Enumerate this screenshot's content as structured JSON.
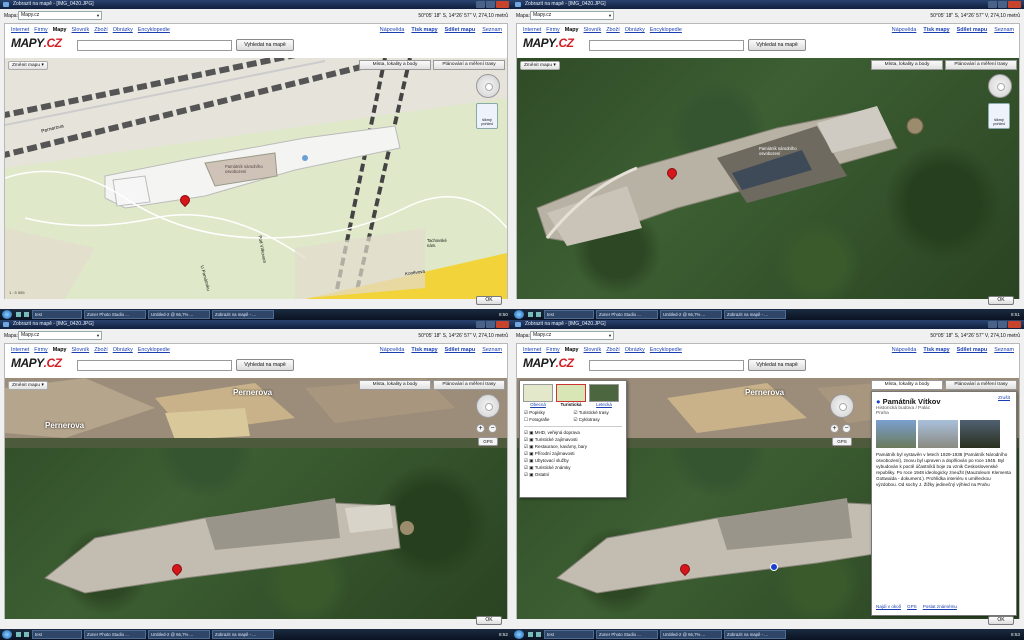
{
  "window": {
    "title": "Zobrazit na mapě - [IMG_0420.JPG]",
    "map_label": "Mapa:",
    "map_select": "Mapy.cz",
    "coords": "50°05' 18\" S, 14°26' 57\" V, 274,10 metrů",
    "ok": "OK"
  },
  "nav": {
    "items": [
      "Internet",
      "Firmy",
      "Mapy",
      "Slovník",
      "Zboží",
      "Obrázky",
      "Encyklopedie"
    ],
    "right": [
      "Nápověda",
      "Tisk mapy",
      "Sdílet mapu",
      "Seznam"
    ]
  },
  "logo": {
    "text_a": "MAPY",
    "text_b": ".CZ"
  },
  "search": {
    "button": "Vyhledat na mapě"
  },
  "map_controls": {
    "change_map": "Změnit mapu ▾",
    "tab_places": "Místa, lokality a body",
    "tab_routes": "Plánování a měření trasy",
    "gps": "GPS",
    "zoom_in": "+",
    "zoom_out": "−",
    "oblique": "šikmý pohled"
  },
  "base_labels": {
    "street1": "Pernerova",
    "street2": "Pod Vítkovem",
    "street3": "U Památníku",
    "street4": "Koněvova",
    "square": "Tachovské nám.",
    "building": "Památník národního osvobození",
    "scale": "1 : 5 555"
  },
  "aerial_labels": {
    "street1": "Pernerova",
    "building": "Památník národního osvobození"
  },
  "layer_panel": {
    "modes": [
      "Obecná",
      "Turistická",
      "Letecká"
    ],
    "opts": [
      "Popisky",
      "Fotografie",
      "Turistické trasy",
      "Cyklotrasy"
    ],
    "layers": [
      "MHD, veřejná doprava",
      "Turistické zajímavosti",
      "Restaurace, kavárny, bary",
      "Přírodní zajímavosti",
      "Ubytovací služby",
      "Turistické známky",
      "Ostatní"
    ]
  },
  "infobox": {
    "close": "Zrušit",
    "title": "Památník Vítkov",
    "subtitle": "Historická budova / Palác",
    "city": "Praha",
    "text": "Památník byl vystavěn v letech 1929-1938 (Památník Národního osvobození), znovu byl upraven a doplňován po roce 1945. Byl vybudován k poctě účastníků boje za vznik Československé republiky. Po roce 1948 ideologicky zneužit (Mauzoleum Klementa Gottwalda - dokument.). Prohlídka interiéru s uměleckou výzdobou. Od sochy J. Žižky jedinečný výhled na Prahu",
    "links": [
      "Najdi v okolí",
      "GPS",
      "Poslat známému"
    ]
  },
  "taskbar": {
    "items": [
      "test",
      "Zoner Photo Studio ...",
      "Untitled-2 @ 66,7% ...",
      "Zobrazit na mapě - ..."
    ],
    "clock_top": "8:50",
    "clock_q1": "8:51",
    "clock_q2": "8:52",
    "clock_q3": "8:53"
  }
}
